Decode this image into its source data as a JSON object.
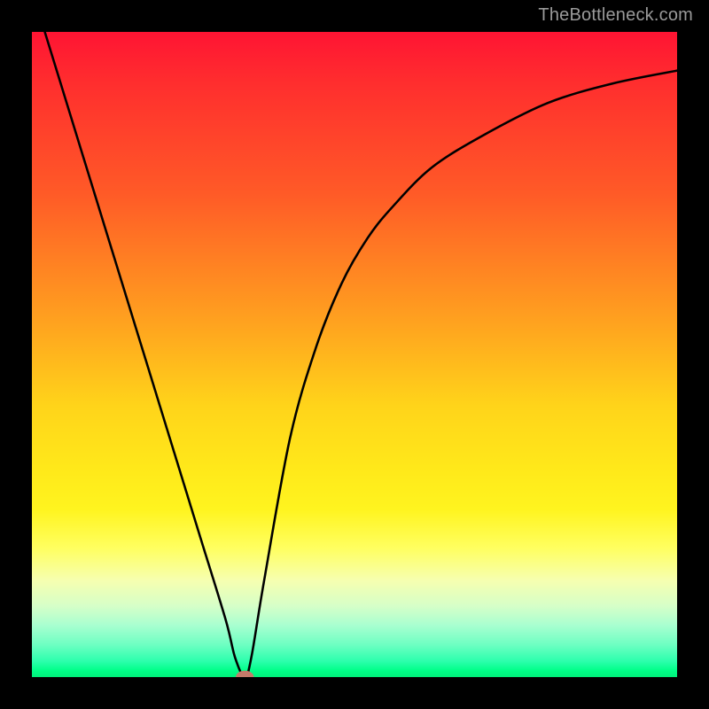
{
  "watermark": {
    "text": "TheBottleneck.com"
  },
  "chart_data": {
    "type": "line",
    "title": "",
    "xlabel": "",
    "ylabel": "",
    "xlim": [
      0,
      100
    ],
    "ylim": [
      0,
      100
    ],
    "grid": false,
    "background_gradient": {
      "direction": "top-to-bottom",
      "stops": [
        {
          "pos": 0,
          "color": "#ff1433"
        },
        {
          "pos": 50,
          "color": "#ffd41a"
        },
        {
          "pos": 80,
          "color": "#ffff60"
        },
        {
          "pos": 95,
          "color": "#6dffc2"
        },
        {
          "pos": 100,
          "color": "#00f07a"
        }
      ]
    },
    "series": [
      {
        "name": "bottleneck-curve",
        "color": "#000000",
        "x": [
          2,
          6,
          10,
          14,
          18,
          22,
          26,
          30,
          31.5,
          33,
          34,
          36,
          40,
          44,
          48,
          52,
          56,
          62,
          70,
          80,
          90,
          100
        ],
        "y": [
          100,
          87,
          74,
          61,
          48,
          35,
          22,
          9,
          3,
          0,
          3,
          15,
          37,
          51,
          61,
          68,
          73,
          79,
          84,
          89,
          92,
          94
        ]
      }
    ],
    "marker": {
      "name": "minimum-point",
      "x": 33,
      "y": 0,
      "color": "#c67a6a",
      "rx": 1.4,
      "ry": 1.0
    }
  }
}
